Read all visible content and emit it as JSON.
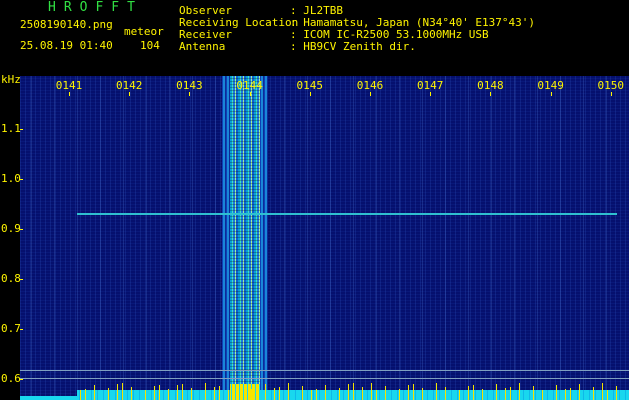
{
  "app": {
    "title": "HROFFT"
  },
  "capture": {
    "filename": "2508190140.png",
    "datetime": "25.08.19 01:40",
    "count_label": "meteor",
    "count_value": "104"
  },
  "station": [
    {
      "key": "Observer",
      "value": ": JL2TBB"
    },
    {
      "key": "Receiving Location",
      "value": ": Hamamatsu, Japan (N34°40' E137°43')"
    },
    {
      "key": "Receiver",
      "value": ": ICOM IC-R2500 53.1000MHz USB"
    },
    {
      "key": "Antenna",
      "value": ": HB9CV Zenith dir."
    }
  ],
  "axes": {
    "y_unit": "kHz",
    "x_ticks": [
      "0141",
      "0142",
      "0143",
      "0144",
      "0145",
      "0146",
      "0147",
      "0148",
      "0149",
      "0150"
    ],
    "y_ticks": [
      "1.1",
      "1.0",
      "0.9",
      "0.8",
      "0.7",
      "0.6"
    ]
  },
  "colors": {
    "background": "#05106e",
    "label": "#fff400",
    "title": "#31e043",
    "trace": "#2fc0d0",
    "floor": "#19d7ee"
  }
}
